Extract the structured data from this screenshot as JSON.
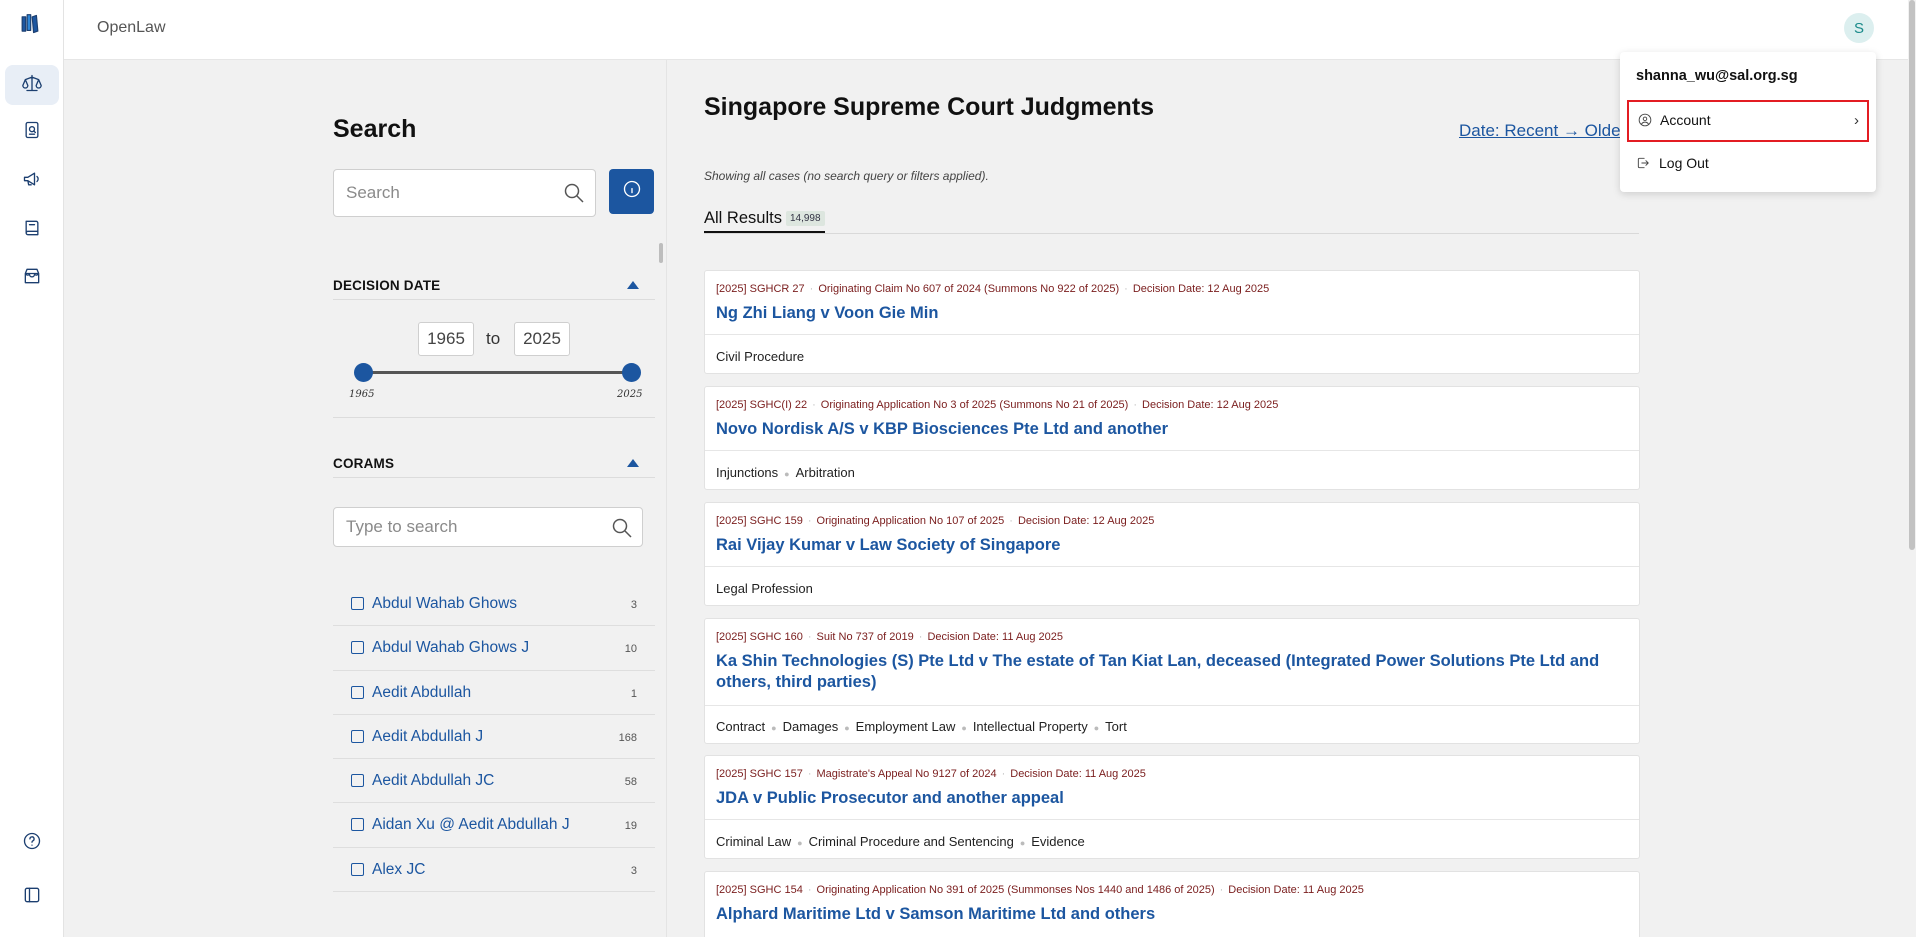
{
  "app": {
    "name": "OpenLaw",
    "avatar_initial": "S"
  },
  "rail": {
    "items": [
      {
        "icon": "scales-icon",
        "active": true
      },
      {
        "icon": "search-document-icon"
      },
      {
        "icon": "megaphone-icon"
      },
      {
        "icon": "book-icon"
      },
      {
        "icon": "store-icon"
      }
    ],
    "bottom": [
      {
        "icon": "help-icon"
      },
      {
        "icon": "sidebar-toggle-icon"
      }
    ]
  },
  "search_panel": {
    "title": "Search",
    "search_placeholder": "Search",
    "decision_date": {
      "label": "DECISION DATE",
      "from": "1965",
      "to_label": "to",
      "to": "2025",
      "min_tick": "1965",
      "max_tick": "2025",
      "range_fraction": [
        0,
        1
      ]
    },
    "corams": {
      "label": "CORAMS",
      "search_placeholder": "Type to search",
      "items": [
        {
          "name": "Abdul Wahab Ghows",
          "count": "3"
        },
        {
          "name": "Abdul Wahab Ghows J",
          "count": "10"
        },
        {
          "name": "Aedit Abdullah",
          "count": "1"
        },
        {
          "name": "Aedit Abdullah J",
          "count": "168"
        },
        {
          "name": "Aedit Abdullah JC",
          "count": "58"
        },
        {
          "name": "Aidan Xu @ Aedit Abdullah J",
          "count": "19"
        },
        {
          "name": "Alex JC",
          "count": "3"
        }
      ]
    }
  },
  "results": {
    "title": "Singapore Supreme Court Judgments",
    "sort_label": "Date: Recent → Oldest",
    "showing_text": "Showing all cases (no search query or filters applied).",
    "tab": {
      "label": "All Results",
      "count": "14,998"
    },
    "cases": [
      {
        "citation": "[2025] SGHCR 27",
        "case_no": "Originating Claim No 607 of 2024 (Summons No 922 of 2025)",
        "decision_date": "Decision Date: 12 Aug 2025",
        "title": "Ng Zhi Liang v Voon Gie Min",
        "tags": [
          "Civil Procedure"
        ]
      },
      {
        "citation": "[2025] SGHC(I) 22",
        "case_no": "Originating Application No 3 of 2025 (Summons No 21 of 2025)",
        "decision_date": "Decision Date: 12 Aug 2025",
        "title": "Novo Nordisk A/S v KBP Biosciences Pte Ltd and another",
        "tags": [
          "Injunctions",
          "Arbitration"
        ]
      },
      {
        "citation": "[2025] SGHC 159",
        "case_no": "Originating Application No 107 of 2025",
        "decision_date": "Decision Date: 12 Aug 2025",
        "title": "Rai Vijay Kumar v Law Society of Singapore",
        "tags": [
          "Legal Profession"
        ]
      },
      {
        "citation": "[2025] SGHC 160",
        "case_no": "Suit No 737 of 2019",
        "decision_date": "Decision Date: 11 Aug 2025",
        "title": "Ka Shin Technologies (S) Pte Ltd v The estate of Tan Kiat Lan, deceased (Integrated Power Solutions Pte Ltd and others, third parties)",
        "tags": [
          "Contract",
          "Damages",
          "Employment Law",
          "Intellectual Property",
          "Tort"
        ]
      },
      {
        "citation": "[2025] SGHC 157",
        "case_no": "Magistrate's Appeal No 9127 of 2024",
        "decision_date": "Decision Date: 11 Aug 2025",
        "title": "JDA v Public Prosecutor and another appeal",
        "tags": [
          "Criminal Law",
          "Criminal Procedure and Sentencing",
          "Evidence"
        ]
      },
      {
        "citation": "[2025] SGHC 154",
        "case_no": "Originating Application No 391 of 2025 (Summonses Nos 1440 and 1486 of 2025)",
        "decision_date": "Decision Date: 11 Aug 2025",
        "title": "Alphard Maritime Ltd v Samson Maritime Ltd and others",
        "tags": []
      }
    ]
  },
  "account_menu": {
    "email": "shanna_wu@sal.org.sg",
    "account_label": "Account",
    "logout_label": "Log Out"
  },
  "colors": {
    "accent": "#1c56a0",
    "highlight": "#e31c23",
    "meta_text": "#7a1d1d"
  }
}
